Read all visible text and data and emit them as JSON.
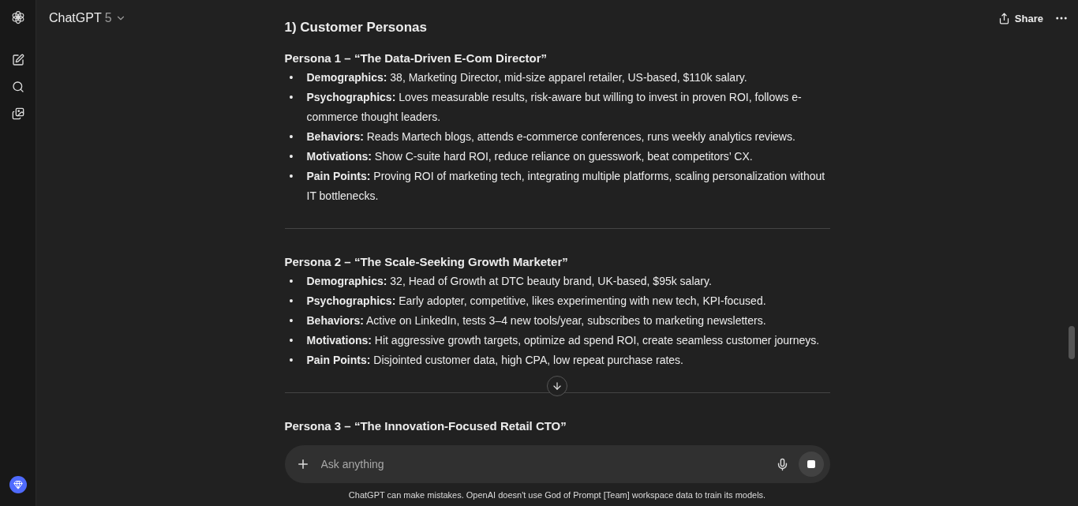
{
  "header": {
    "model_name": "ChatGPT",
    "model_version": "5",
    "share_label": "Share"
  },
  "section_title": "1) Customer Personas",
  "personas": [
    {
      "title": "Persona 1 – “The Data-Driven E-Com Director”",
      "bullets": [
        {
          "label": "Demographics:",
          "text": "38, Marketing Director, mid-size apparel retailer, US-based, $110k salary."
        },
        {
          "label": "Psychographics:",
          "text": "Loves measurable results, risk-aware but willing to invest in proven ROI, follows e-commerce thought leaders."
        },
        {
          "label": "Behaviors:",
          "text": "Reads Martech blogs, attends e-commerce conferences, runs weekly analytics reviews."
        },
        {
          "label": "Motivations:",
          "text": "Show C-suite hard ROI, reduce reliance on guesswork, beat competitors’ CX."
        },
        {
          "label": "Pain Points:",
          "text": "Proving ROI of marketing tech, integrating multiple platforms, scaling personalization without IT bottlenecks."
        }
      ]
    },
    {
      "title": "Persona 2 – “The Scale-Seeking Growth Marketer”",
      "bullets": [
        {
          "label": "Demographics:",
          "text": "32, Head of Growth at DTC beauty brand, UK-based, $95k salary."
        },
        {
          "label": "Psychographics:",
          "text": "Early adopter, competitive, likes experimenting with new tech, KPI-focused."
        },
        {
          "label": "Behaviors:",
          "text": "Active on LinkedIn, tests 3–4 new tools/year, subscribes to marketing newsletters."
        },
        {
          "label": "Motivations:",
          "text": "Hit aggressive growth targets, optimize ad spend ROI, create seamless customer journeys."
        },
        {
          "label": "Pain Points:",
          "text": "Disjointed customer data, high CPA, low repeat purchase rates."
        }
      ]
    },
    {
      "title": "Persona 3 – “The Innovation-Focused Retail CTO”"
    }
  ],
  "bullet_marker": "•",
  "composer": {
    "placeholder": "Ask anything"
  },
  "disclaimer": "ChatGPT can make mistakes. OpenAI doesn't use God of Prompt [Team] workspace data to train its models."
}
